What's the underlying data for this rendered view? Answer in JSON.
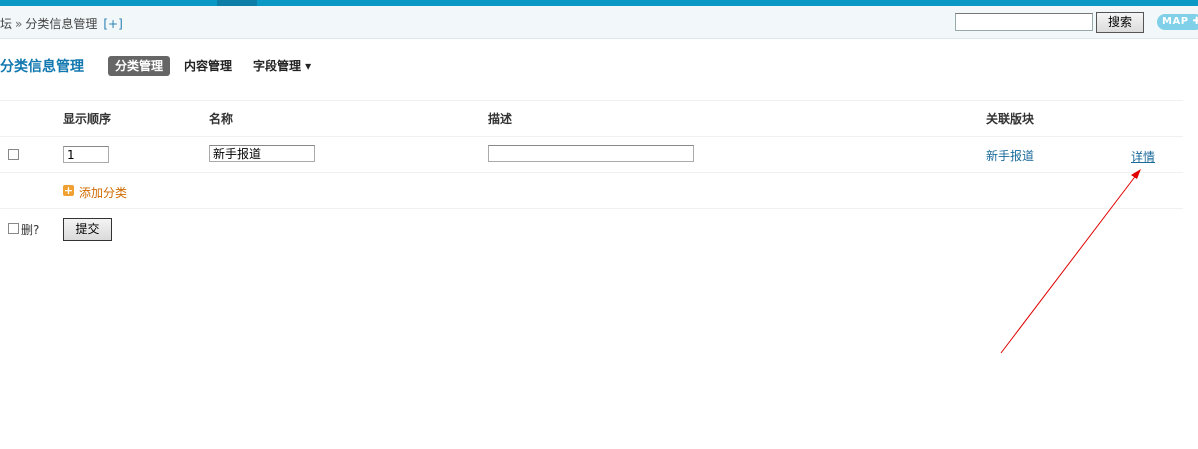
{
  "header": {
    "breadcrumb": {
      "home_fragment": "坛",
      "separator": "»",
      "current": "分类信息管理",
      "add": "[+]"
    },
    "search": {
      "value": "",
      "button_label": "搜索"
    },
    "map_button_label": "MAP ✚"
  },
  "page": {
    "title": "分类信息管理",
    "menu": [
      {
        "label": "分类管理",
        "active": true
      },
      {
        "label": "内容管理",
        "active": false
      },
      {
        "label": "字段管理 ▾",
        "active": false
      }
    ]
  },
  "table": {
    "columns": [
      "显示顺序",
      "名称",
      "描述",
      "关联版块"
    ],
    "rows": [
      {
        "checked": false,
        "order": "1",
        "name": "新手报道",
        "description": "",
        "forum": "新手报道",
        "detail_label": "详情"
      }
    ],
    "add_label": "添加分类",
    "delete_label": "删?",
    "submit_label": "提交"
  },
  "colors": {
    "accent": "#0a99c4",
    "title": "#1178b0",
    "link": "#1a6a9a",
    "add_link": "#d06a00",
    "annotation_arrow": "#e00000"
  }
}
